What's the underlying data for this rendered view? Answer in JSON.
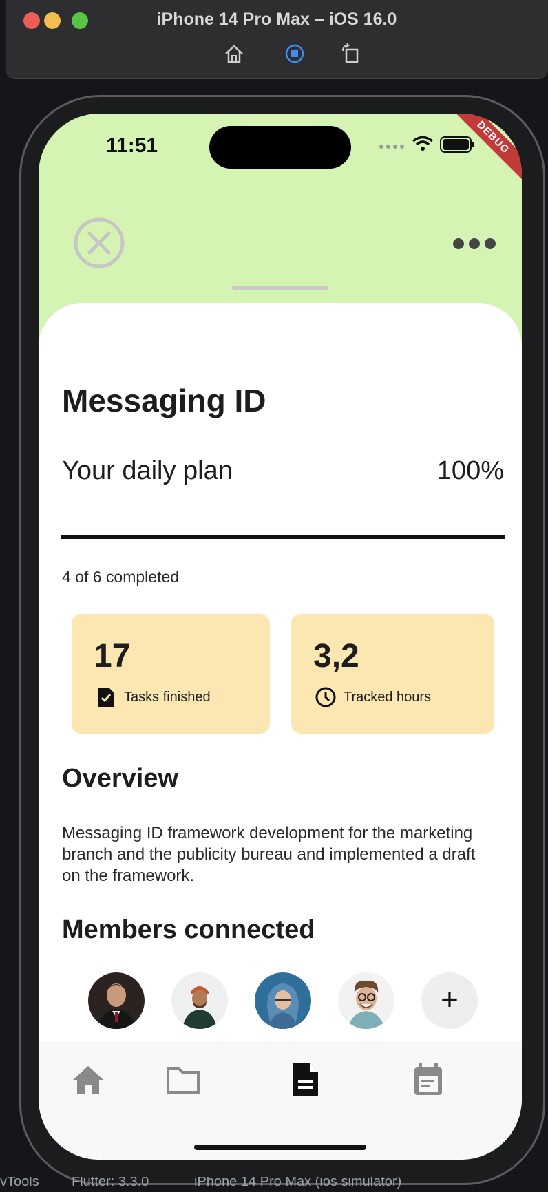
{
  "window": {
    "title": "iPhone 14 Pro Max – iOS 16.0"
  },
  "status_bar": {
    "time": "11:51",
    "debug_badge": "DEBUG"
  },
  "header": {
    "close_icon": "close-circle-icon",
    "more_icon": "more-horizontal-icon"
  },
  "project": {
    "title": "Messaging ID",
    "plan_label": "Your daily plan",
    "plan_percent": "100%",
    "progress_fraction": 1.0,
    "completed_text": "4 of 6 completed"
  },
  "stats": [
    {
      "value": "17",
      "label": "Tasks finished",
      "icon": "task-done-icon"
    },
    {
      "value": "3,2",
      "label": "Tracked hours",
      "icon": "clock-icon"
    }
  ],
  "overview": {
    "title": "Overview",
    "text": "Messaging ID framework development for the marketing branch and the publicity bureau and implemented a draft on the framework."
  },
  "members": {
    "title": "Members connected",
    "add_label": "+"
  },
  "tabs": [
    {
      "icon": "home-icon",
      "active": false
    },
    {
      "icon": "folder-icon",
      "active": false
    },
    {
      "icon": "document-icon",
      "active": true
    },
    {
      "icon": "calendar-icon",
      "active": false
    }
  ],
  "footer": {
    "devtools_label": "vTools",
    "flutter_label": "Flutter: 3.3.0",
    "device_label": "iPhone 14 Pro Max (ios simulator)"
  },
  "colors": {
    "header_bg": "#d5f3b3",
    "card_bg": "#fce7b3",
    "accent_text": "#1d1d1d",
    "debug_ribbon": "#c23b3b"
  }
}
